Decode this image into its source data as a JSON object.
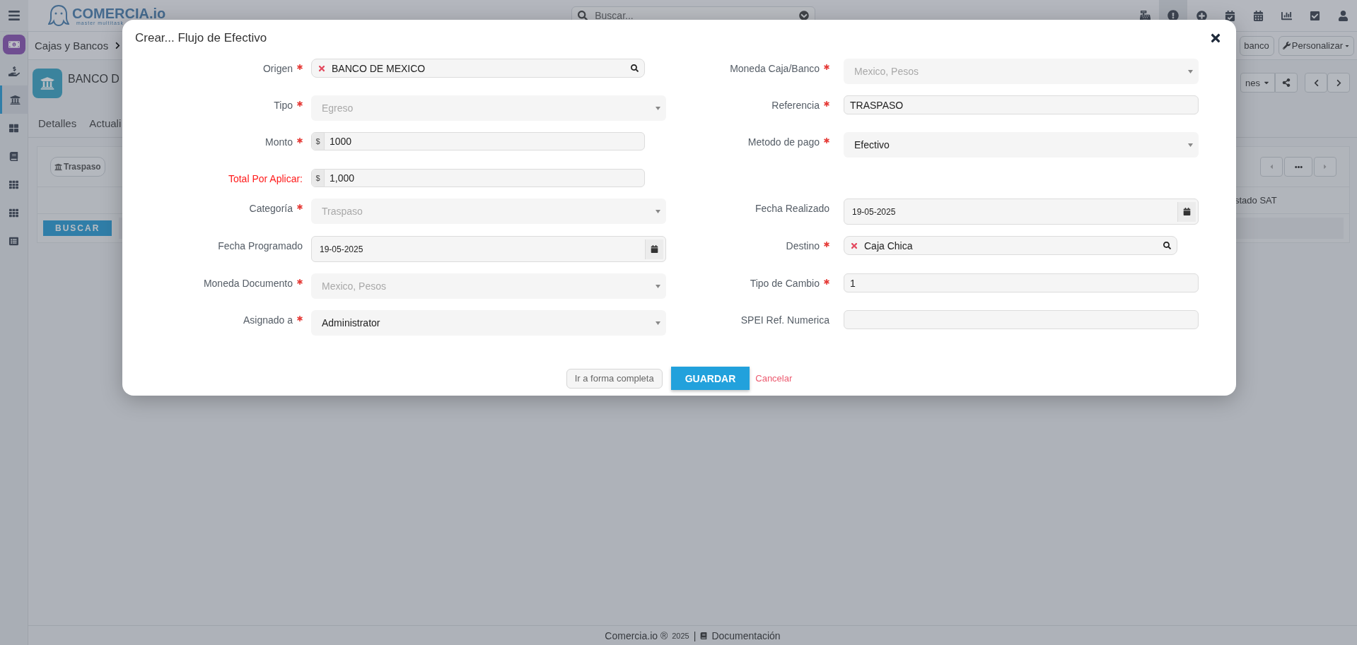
{
  "app": {
    "logo": {
      "name": "COMERCIA.io",
      "tagline": "master multitask"
    },
    "search": {
      "placeholder": "Buscar..."
    },
    "breadcrumb": {
      "label": "Cajas y Bancos"
    },
    "record": {
      "title": "BANCO D",
      "tabs": [
        {
          "label": "Detalles",
          "selected": false
        },
        {
          "label": "Actuali",
          "selected": false
        }
      ]
    },
    "header_buttons": {
      "partial": "banco",
      "customize": "Personalizar",
      "actions_partial": "nes"
    },
    "panel": {
      "filter_button": "Traspaso",
      "search_button": "BUSCAR",
      "column_header": "stado SAT"
    },
    "footer": {
      "brand": "Comercia.io ®",
      "year": "2025",
      "separator": "|",
      "docs": "Documentación"
    }
  },
  "modal": {
    "title": "Crear... Flujo de Efectivo",
    "rows": [
      {
        "left": {
          "label": "Origen",
          "required": true,
          "kind": "search",
          "value": "BANCO  DE MEXICO",
          "disabled": false
        },
        "right": {
          "label": "Moneda Caja/Banco",
          "required": true,
          "kind": "select",
          "value": "Mexico, Pesos",
          "disabled": true
        }
      },
      {
        "left": {
          "label": "Tipo",
          "required": true,
          "kind": "select",
          "value": "Egreso",
          "disabled": true
        },
        "right": {
          "label": "Referencia",
          "required": true,
          "kind": "text",
          "value": "TRASPASO",
          "disabled": false
        }
      },
      {
        "left": {
          "label": "Monto",
          "required": true,
          "kind": "money",
          "prefix": "$",
          "value": "1000",
          "disabled": false
        },
        "right": {
          "label": "Metodo de pago",
          "required": true,
          "kind": "select",
          "value": "Efectivo",
          "disabled": false
        }
      },
      {
        "left": {
          "label": "Total Por Aplicar:",
          "required": false,
          "highlighted": true,
          "kind": "money",
          "prefix": "$",
          "value": "1,000",
          "disabled": false
        }
      },
      {
        "left": {
          "label": "Categoría",
          "required": true,
          "kind": "select",
          "value": "Traspaso",
          "disabled": true
        },
        "right": {
          "label": "Fecha Realizado",
          "required": false,
          "kind": "date",
          "value": "19-05-2025",
          "disabled": false
        }
      },
      {
        "left": {
          "label": "Fecha Programado",
          "required": false,
          "kind": "date",
          "value": "19-05-2025",
          "disabled": false
        },
        "right": {
          "label": "Destino",
          "required": true,
          "kind": "search",
          "value": "Caja Chica",
          "disabled": false
        }
      },
      {
        "left": {
          "label": "Moneda Documento",
          "required": true,
          "kind": "select",
          "value": "Mexico, Pesos",
          "disabled": true
        },
        "right": {
          "label": "Tipo de Cambio",
          "required": true,
          "kind": "text",
          "value": "1",
          "disabled": false
        }
      },
      {
        "left": {
          "label": "Asignado a",
          "required": true,
          "kind": "select",
          "value": "Administrator",
          "disabled": false
        },
        "right": {
          "label": "SPEI Ref. Numerica",
          "required": false,
          "kind": "text",
          "disabled": false
        }
      }
    ],
    "buttons": {
      "full_form": "Ir a forma completa",
      "save": "GUARDAR",
      "cancel": "Cancelar"
    }
  }
}
